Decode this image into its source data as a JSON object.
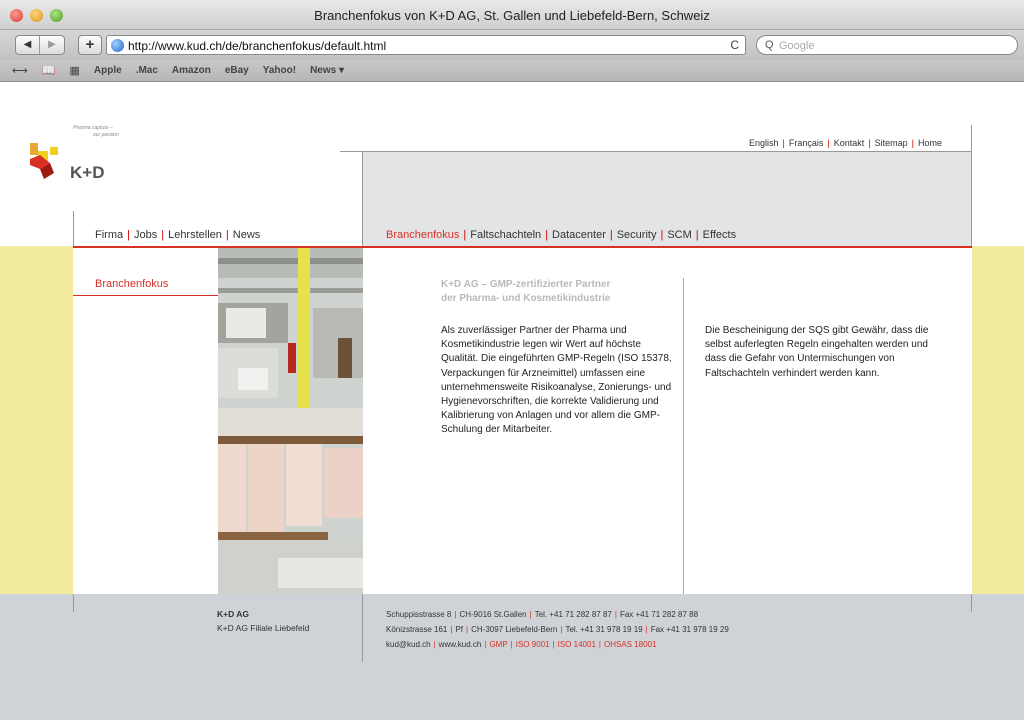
{
  "window": {
    "title": "Branchenfokus von K+D AG, St. Gallen und Liebefeld-Bern, Schweiz"
  },
  "toolbar": {
    "back": "◀",
    "forward": "▶",
    "add": "+",
    "url": "http://www.kud.ch/de/branchenfokus/default.html",
    "reload": "C",
    "search_icon": "Q",
    "search_placeholder": "Google"
  },
  "bookmarks": {
    "icons": [
      "bookmarks-reading-icon",
      "book-icon",
      "grid-icon"
    ],
    "icon_glyphs": [
      "⟷",
      "📖",
      "▦"
    ],
    "items": [
      "Apple",
      ".Mac",
      "Amazon",
      "eBay",
      "Yahoo!",
      "News ▾"
    ]
  },
  "site": {
    "tagline_1": "Pharma capture –",
    "tagline_2": "our passion",
    "brand": "K+D",
    "util_nav": [
      "English",
      "Français",
      "Kontakt",
      "Sitemap",
      "Home"
    ],
    "left_nav": [
      "Firma",
      "Jobs",
      "Lehrstellen",
      "News"
    ],
    "main_nav": [
      "Branchenfokus",
      "Faltschachteln",
      "Datacenter",
      "Security",
      "SCM",
      "Effects"
    ],
    "sidebar_link": "Branchenfokus",
    "heading_1": "K+D AG – GMP-zertifizierter Partner",
    "heading_2": "der Pharma- und Kosmetikindustrie",
    "para_left": "Als zuverlässiger Partner der Pharma und Kosmetikindustrie legen wir Wert auf höchste Qualität. Die eingeführten GMP-Regeln (ISO 15378, Verpackungen für Arzneimittel) umfassen eine unternehmensweite Risikoanalyse, Zonierungs- und Hygienevorschriften, die korrekte Validierung und Kalibrierung von Anlagen und vor allem die GMP-Schulung der Mitarbeiter.",
    "para_right": "Die Bescheinigung der SQS gibt Gewähr, dass die selbst auferlegten Regeln eingehalten werden und dass die Gefahr von Untermischungen von Faltschachteln verhindert werden kann."
  },
  "footer": {
    "company_1": "K+D AG",
    "company_2": "K+D AG Filiale Liebefeld",
    "addr_1": [
      "Schuppisstrasse 8",
      "CH-9016 St.Gallen",
      "Tel. +41 71 282 87 87",
      "Fax +41 71 282 87 88"
    ],
    "addr_2": [
      "Könizstrasse 161",
      "Pf",
      "CH-3097 Liebefeld-Bern",
      "Tel. +41 31 978 19 19",
      "Fax +41 31 978 19 29"
    ],
    "addr_3_plain": [
      "kud@kud.ch",
      "www.kud.ch"
    ],
    "addr_3_certs": [
      "GMP",
      "ISO 9001",
      "ISO 14001",
      "OHSAS 18001"
    ]
  },
  "colors": {
    "accent": "#d93025",
    "band": "#f2ea9c",
    "gray": "#e2e4e6"
  }
}
